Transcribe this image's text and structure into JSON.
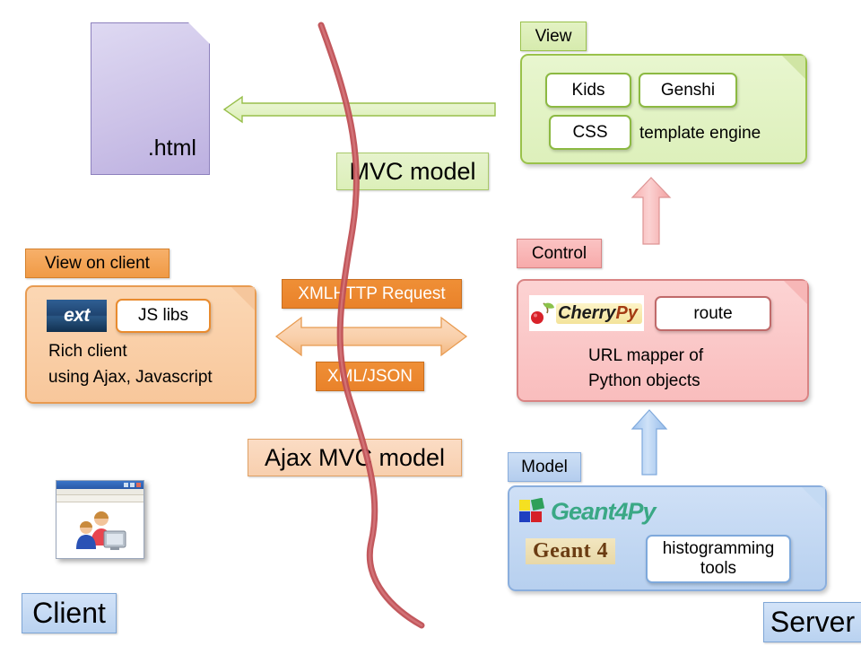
{
  "diagram": {
    "title": "Ajax MVC web application architecture (Geant4Py)",
    "colors": {
      "green": "#9ac24a",
      "red": "#d98484",
      "blue": "#8aaedd",
      "orange": "#e9822a",
      "purple": "#bcb0e0",
      "curve_red": "#bf4f54"
    }
  },
  "client": {
    "zone_label": "Client",
    "html_doc": {
      "label": ".html",
      "icon": "document-icon"
    },
    "view_on_client": {
      "tag": "View on client",
      "logo_ext": "ext",
      "js_libs_chip": "JS libs",
      "description_line1": "Rich client",
      "description_line2": "using Ajax, Javascript"
    },
    "browser_screenshot": {
      "icon": "browser-window-users-icon"
    }
  },
  "server": {
    "zone_label": "Server",
    "view": {
      "tag": "View",
      "chips": [
        "Kids",
        "Genshi",
        "CSS"
      ],
      "caption": "template engine"
    },
    "control": {
      "tag": "Control",
      "logo": "CherryPy",
      "logo_parts": {
        "first": "Cherry",
        "second": "Py"
      },
      "chip": "route",
      "description_line1": "URL mapper of",
      "description_line2": "Python objects"
    },
    "model": {
      "tag": "Model",
      "logo_g4py": "Geant4Py",
      "logo_geant4": "Geant 4",
      "chip_line1": "histogramming",
      "chip_line2": "tools"
    }
  },
  "center": {
    "mvc_model_label": "MVC model",
    "ajax_mvc_model_label": "Ajax MVC model",
    "xmlhttp_request_label": "XMLHTTP Request",
    "xml_json_label": "XML/JSON"
  },
  "arrows": {
    "html_response": {
      "name": "green-left-arrow",
      "direction": "left"
    },
    "ajax_bidirectional": {
      "name": "orange-double-arrow",
      "direction": "both"
    },
    "control_to_view": {
      "name": "red-up-arrow",
      "direction": "up"
    },
    "model_to_control": {
      "name": "blue-up-arrow",
      "direction": "up"
    },
    "boundary_curve": {
      "name": "client-server-boundary-curve"
    }
  }
}
